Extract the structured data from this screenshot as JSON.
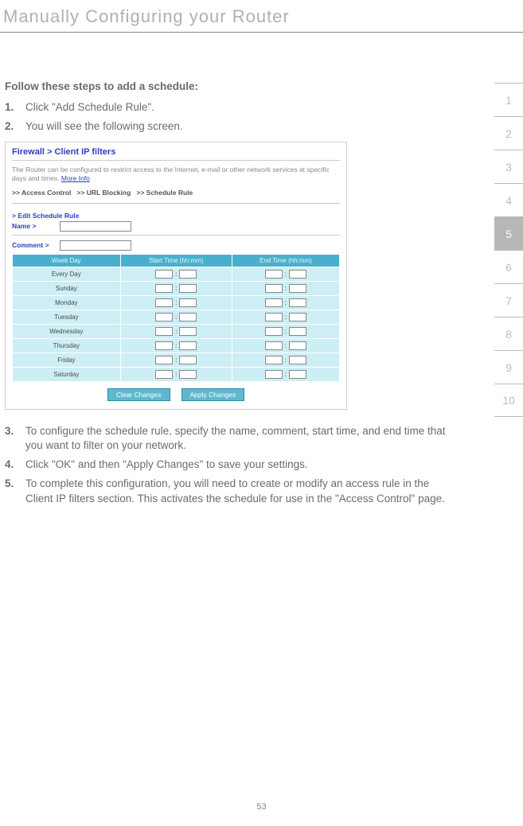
{
  "page": {
    "title": "Manually Configuring your Router",
    "intro": "Follow these steps to add a schedule:",
    "page_number": "53"
  },
  "steps": {
    "s1_num": "1.",
    "s1_txt": "Click \"Add Schedule Rule\".",
    "s2_num": "2.",
    "s2_txt": "You will see the following screen.",
    "s3_num": "3.",
    "s3_txt": "To configure the schedule rule, specify the name, comment, start time, and end time that you want to filter on your network.",
    "s4_num": "4.",
    "s4_txt": "Click \"OK\" and then \"Apply Changes\" to save your settings.",
    "s5_num": "5.",
    "s5_txt": "To complete this configuration, you will need to create or modify an access rule in the Client IP filters section. This activates the schedule for use in the \"Access Control\" page."
  },
  "screenshot": {
    "title": "Firewall > Client IP filters",
    "desc_text": "The Router can be configured to restrict access to the Internet, e-mail or other network services at specific days and times. ",
    "desc_link": "More Info",
    "nav1": ">> Access Control",
    "nav2": ">> URL Blocking",
    "nav3": ">> Schedule Rule",
    "edit_title": "> Edit Schedule Rule",
    "name_lbl": "Name >",
    "comment_lbl": "Comment >",
    "table": {
      "h1": "Week Day",
      "h2": "Start Time (hh:mm)",
      "h3": "End Time (hh:mm)",
      "days": [
        "Every Day",
        "Sunday",
        "Monday",
        "Tuesday",
        "Wednesday",
        "Thursday",
        "Friday",
        "Saturday"
      ]
    },
    "btn_clear": "Clear Changes",
    "btn_apply": "Apply Changes"
  },
  "tabs": {
    "t1": "1",
    "t2": "2",
    "t3": "3",
    "t4": "4",
    "t5": "5",
    "t6": "6",
    "t7": "7",
    "t8": "8",
    "t9": "9",
    "t10": "10"
  }
}
